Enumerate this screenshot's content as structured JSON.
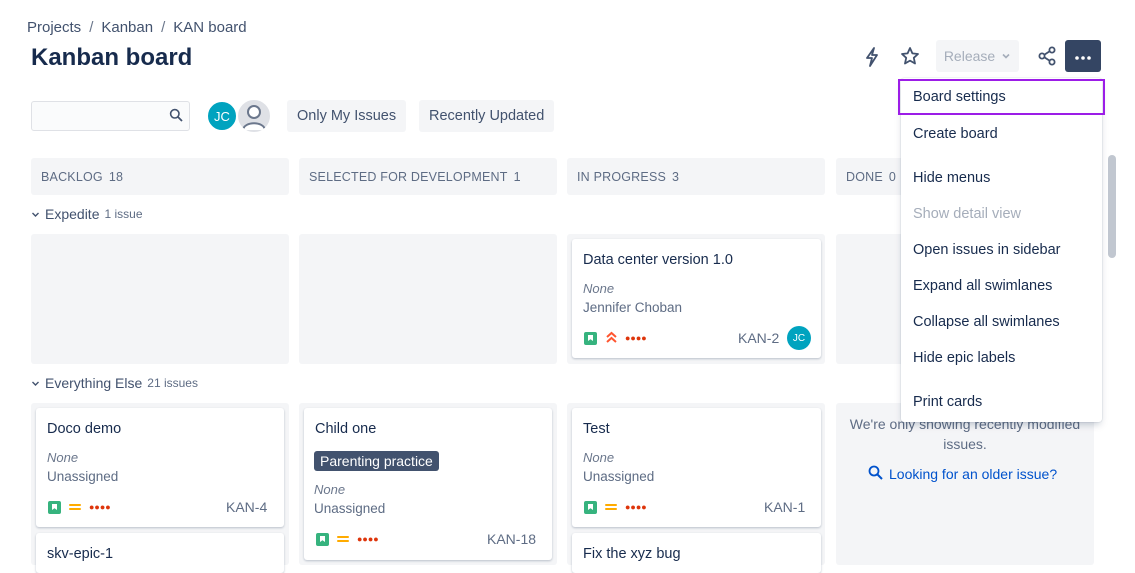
{
  "breadcrumb": [
    "Projects",
    "Kanban",
    "KAN board"
  ],
  "page_title": "Kanban board",
  "header": {
    "release_label": "Release",
    "icons": [
      "lightning-icon",
      "star-icon",
      "chevron-down-icon",
      "share-icon",
      "more-icon"
    ]
  },
  "filters": {
    "search_value": "",
    "avatar_initials": "JC",
    "only_my_issues": "Only My Issues",
    "recently_updated": "Recently Updated"
  },
  "columns": [
    {
      "name": "BACKLOG",
      "count": "18"
    },
    {
      "name": "SELECTED FOR DEVELOPMENT",
      "count": "1"
    },
    {
      "name": "IN PROGRESS",
      "count": "3"
    },
    {
      "name": "DONE",
      "count": "0"
    }
  ],
  "swimlanes": [
    {
      "name": "Expedite",
      "count_label": "1 issue"
    },
    {
      "name": "Everything Else",
      "count_label": "21 issues"
    }
  ],
  "cards": {
    "expedite_in_progress": {
      "summary": "Data center version 1.0",
      "epic": "None",
      "assignee": "Jennifer Choban",
      "key": "KAN-2",
      "avatar": "JC",
      "dots": "●●●●"
    },
    "doco_demo": {
      "summary": "Doco demo",
      "epic": "None",
      "assignee": "Unassigned",
      "key": "KAN-4",
      "dots": "●●●●"
    },
    "skv_epic": {
      "summary": "skv-epic-1"
    },
    "child_one": {
      "summary": "Child one",
      "label": "Parenting practice",
      "epic": "None",
      "assignee": "Unassigned",
      "key": "KAN-18",
      "dots": "●●●●"
    },
    "test": {
      "summary": "Test",
      "epic": "None",
      "assignee": "Unassigned",
      "key": "KAN-1",
      "dots": "●●●●"
    },
    "fix_bug": {
      "summary": "Fix the xyz bug"
    }
  },
  "done_column": {
    "message": "We're only showing recently modified issues.",
    "link": "Looking for an older issue?"
  },
  "menu": {
    "items": [
      {
        "label": "Board settings"
      },
      {
        "label": "Create board"
      },
      {
        "label": "Hide menus"
      },
      {
        "label": "Show detail view"
      },
      {
        "label": "Open issues in sidebar"
      },
      {
        "label": "Expand all swimlanes"
      },
      {
        "label": "Collapse all swimlanes"
      },
      {
        "label": "Hide epic labels"
      },
      {
        "label": "Print cards"
      }
    ]
  },
  "colors": {
    "accent": "#344563",
    "focus_ring": "#9c1de7",
    "story": "#36b37e",
    "priority_medium": "#ffab00",
    "priority_high": "#ff5630",
    "link": "#0052cc",
    "avatar": "#00a3bf"
  }
}
